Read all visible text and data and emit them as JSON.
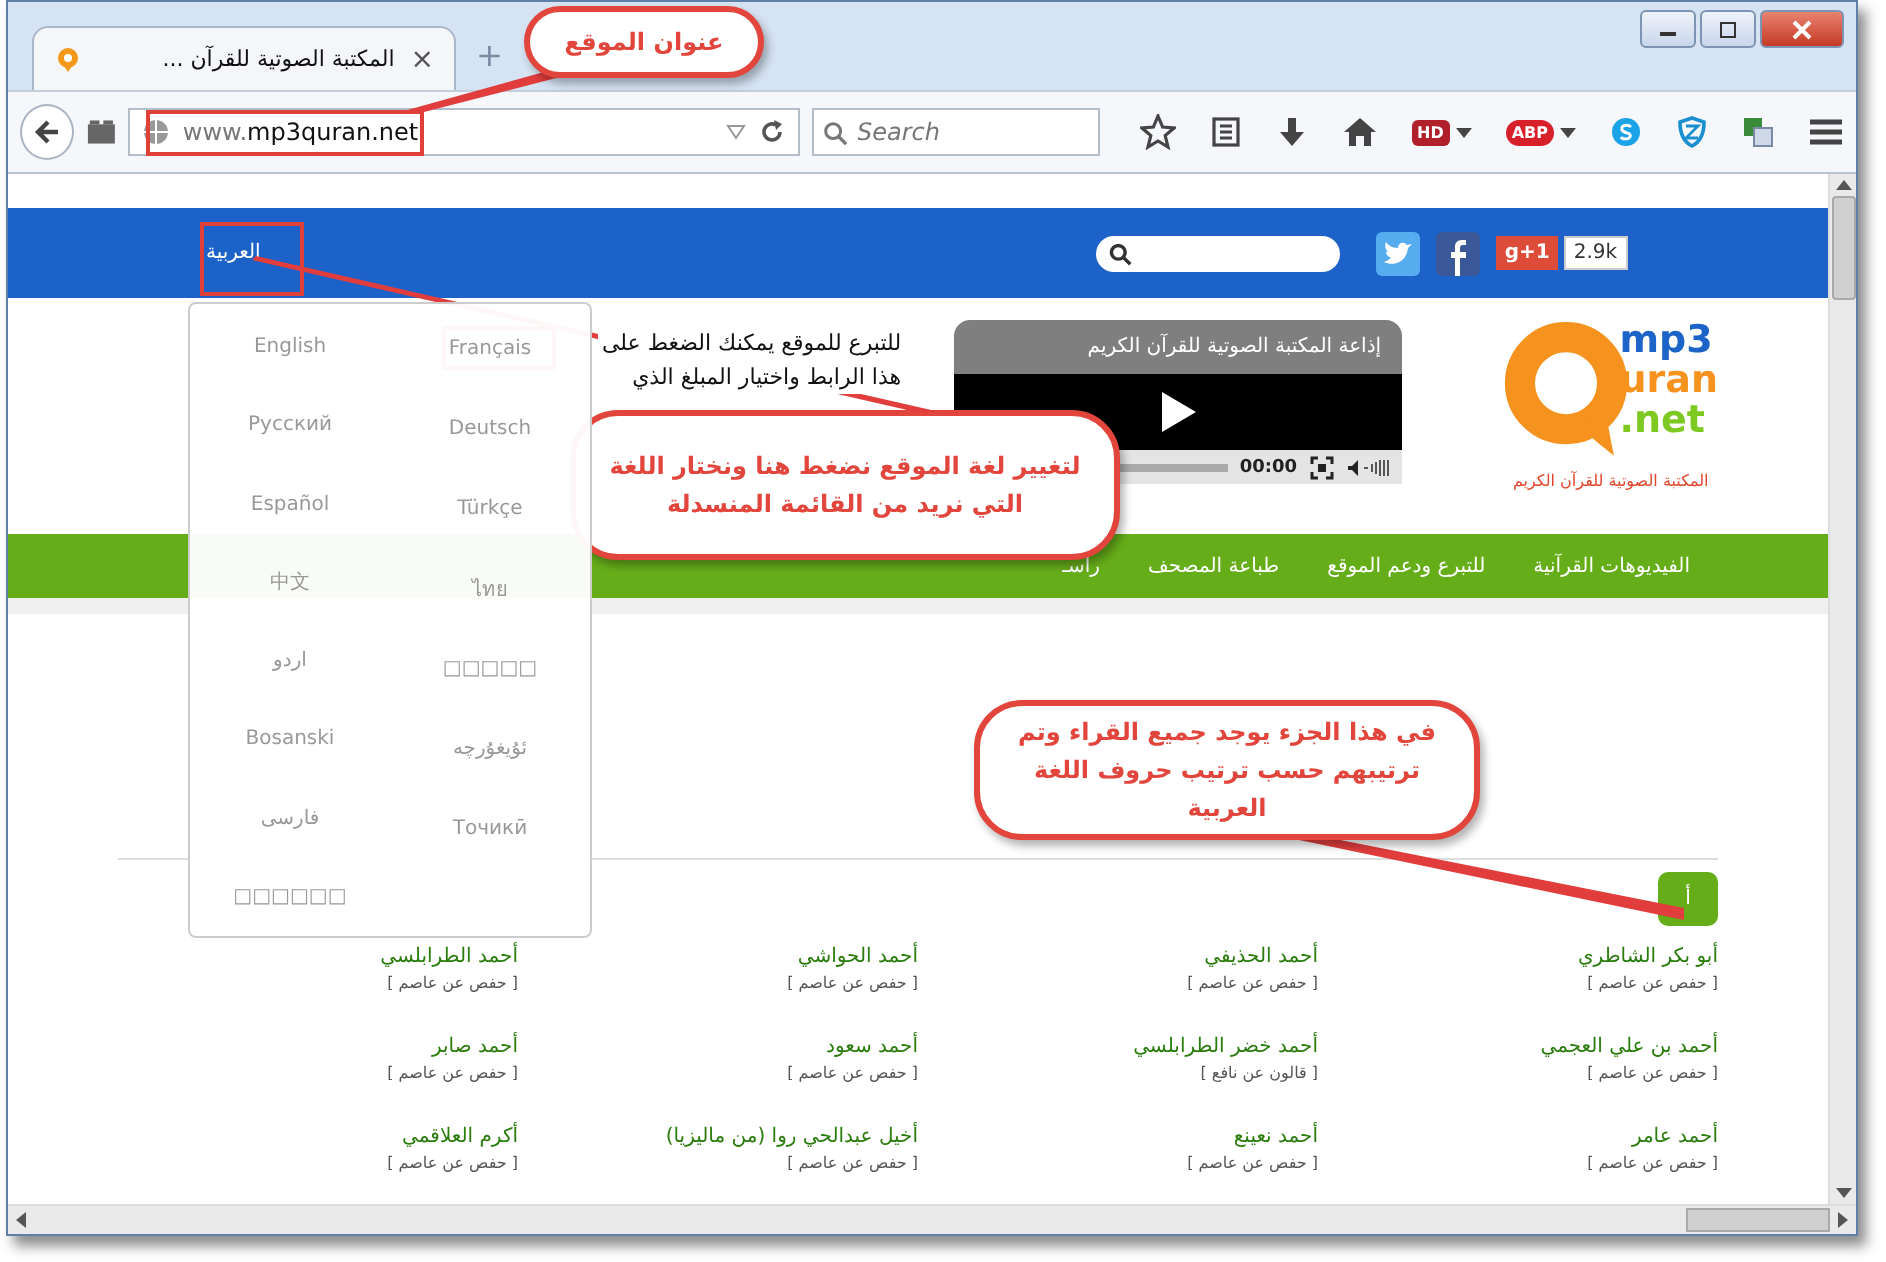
{
  "browser": {
    "tab_title": "المكتبة الصوتية للقرآن ...",
    "tab_close": "×",
    "new_tab": "+",
    "address": {
      "prefix": "www.",
      "domain": "mp3quran.net"
    },
    "search": {
      "placeholder": "Search"
    },
    "hd_addon": "HD",
    "adblock_addon": "ABP"
  },
  "site": {
    "header": {
      "language": "العربية",
      "gplus": "g+1",
      "share_count": "2.9k"
    },
    "logo": {
      "line_1": "mp3",
      "line_2": "uran",
      "line_3": ".net",
      "tagline": "المكتبة الصوتية للقرآن الكريم"
    },
    "player": {
      "title": "إذاعة المكتبة الصوتية للقرآن الكريم",
      "time": "00:00"
    },
    "donate": {
      "lines": [
        "للتبرع للموقع يمكنك الضغط على",
        "هذا الرابط واختيار المبلغ الذي"
      ]
    },
    "nav": [
      "الفيديوهات القرآنية",
      "للتبرع ودعم الموقع",
      "طباعة المصحف",
      "راسـ"
    ],
    "language_menu": {
      "left_column": [
        "English",
        "Русский",
        "Español",
        "中文",
        "اردو",
        "Bosanski",
        "فارسی",
        "□□□□□□"
      ],
      "right_column": [
        "Français",
        "Deutsch",
        "Türkçe",
        "ไทย",
        "□□□□□",
        "ئۇيغۇرچە",
        "Точикӣ"
      ]
    },
    "letter": "أ",
    "readers": [
      {
        "name": "أبو بكر الشاطري",
        "narration": "[ حفص عن عاصم ]"
      },
      {
        "name": "أحمد الحذيفي",
        "narration": "[ حفص عن عاصم ]"
      },
      {
        "name": "أحمد الحواشي",
        "narration": "[ حفص عن عاصم ]"
      },
      {
        "name": "أحمد الطرابلسي",
        "narration": "[ حفص عن عاصم ]"
      },
      {
        "name": "أحمد بن علي العجمي",
        "narration": "[ حفص عن عاصم ]"
      },
      {
        "name": "أحمد خضر الطرابلسي",
        "narration": "[ قالون عن نافع ]"
      },
      {
        "name": "أحمد سعود",
        "narration": "[ حفص عن عاصم ]"
      },
      {
        "name": "أحمد صابر",
        "narration": "[ حفص عن عاصم ]"
      },
      {
        "name": "أحمد عامر",
        "narration": "[ حفص عن عاصم ]"
      },
      {
        "name": "أحمد نعينع",
        "narration": "[ حفص عن عاصم ]"
      },
      {
        "name": "أخيل عبدالحي روا (من ماليزيا)",
        "narration": "[ حفص عن عاصم ]"
      },
      {
        "name": "أكرم العلاقمي",
        "narration": "[ حفص عن عاصم ]"
      }
    ]
  },
  "annotations": [
    "عنوان الموقع",
    "لتغيير لغة الموقع نضغط هنا ونختار اللغة التي نريد من القائمة المنسدلة",
    "في هذا الجزء يوجد جميع القراء وتم ترتيبهم حسب ترتيب حروف اللغة العربية"
  ]
}
